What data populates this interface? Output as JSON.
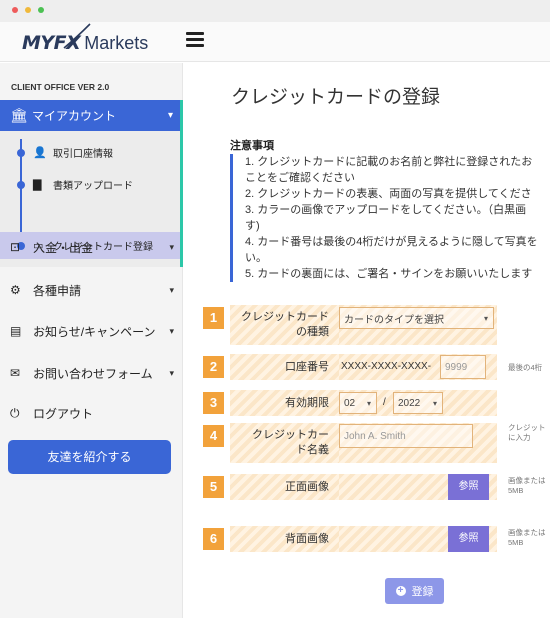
{
  "header": {
    "logo_brand": "MYFX",
    "logo_suffix": "Markets"
  },
  "sidebar": {
    "version": "CLIENT OFFICE VER 2.0",
    "active_item": {
      "label": "マイアカウント",
      "icon": "bank-icon"
    },
    "sub_items": [
      {
        "label": "取引口座情報",
        "icon": "user-icon"
      },
      {
        "label": "書類アップロード",
        "icon": "document-icon"
      },
      {
        "label": "クレジットカード登録",
        "icon": "credit-card-icon"
      }
    ],
    "items": [
      {
        "label": "入金・出金",
        "icon": "money-icon"
      },
      {
        "label": "各種申請",
        "icon": "gears-icon"
      },
      {
        "label": "お知らせ/キャンペーン",
        "icon": "newspaper-icon"
      },
      {
        "label": "お問い合わせフォーム",
        "icon": "envelope-icon"
      },
      {
        "label": "ログアウト",
        "icon": "power-icon"
      }
    ],
    "referral_button": "友達を紹介する"
  },
  "main": {
    "title": "クレジットカードの登録",
    "notes_title": "注意事項",
    "notes": [
      "1. クレジットカードに記載のお名前と弊社に登録されたお",
      "ことをご確認ください",
      "2. クレジットカードの表裏、両面の写真を提供してくださ",
      "3. カラーの画像でアップロードをしてください。（白黒画",
      "す)",
      "4. カード番号は最後の4桁だけが見えるように隠して写真を",
      "い。",
      "5. カードの裏面には、ご署名・サインをお願いいたします"
    ]
  },
  "form": {
    "card_type": {
      "number": "1",
      "label_line1": "クレジットカード",
      "label_line2": "の種類",
      "selected": "カードのタイプを選択"
    },
    "card_number": {
      "number": "2",
      "label": "口座番号",
      "masked_prefix": "XXXX-XXXX-XXXX-",
      "placeholder": "9999",
      "help": "最後の4桁"
    },
    "expiry": {
      "number": "3",
      "label": "有効期限",
      "month": "02",
      "separator": "/",
      "year": "2022"
    },
    "card_name": {
      "number": "4",
      "label_line1": "クレジットカー",
      "label_line2": "ド名義",
      "placeholder": "John A. Smith",
      "help_line1": "クレジット",
      "help_line2": "に入力"
    },
    "front_image": {
      "number": "5",
      "label": "正面画像",
      "browse": "参照",
      "help_line1": "画像または",
      "help_line2": "5MB"
    },
    "back_image": {
      "number": "6",
      "label": "背面画像",
      "browse": "参照",
      "help_line1": "画像または",
      "help_line2": "5MB"
    },
    "submit": "登録"
  }
}
